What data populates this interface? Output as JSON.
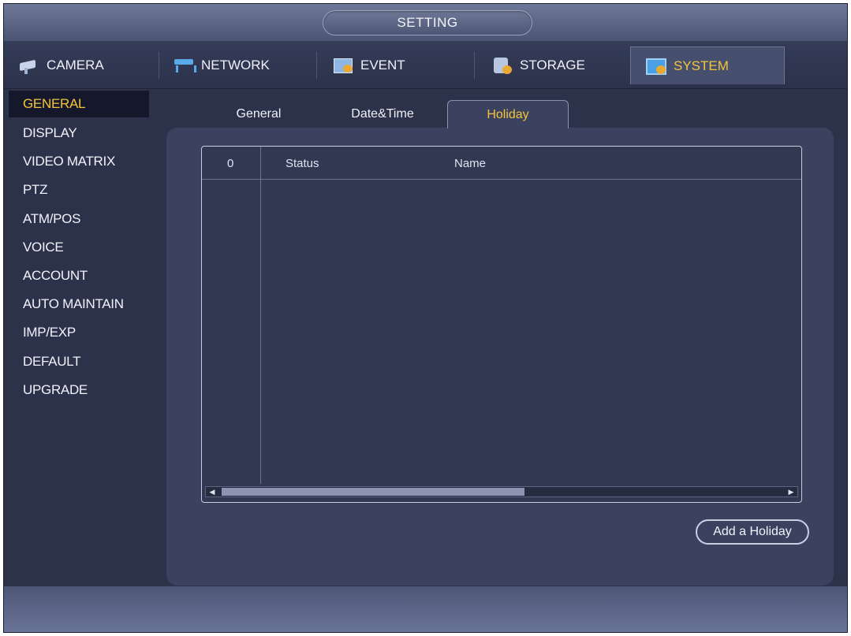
{
  "window": {
    "title": "SETTING"
  },
  "main_tabs": [
    {
      "label": "CAMERA",
      "icon": "camera-icon"
    },
    {
      "label": "NETWORK",
      "icon": "network-icon"
    },
    {
      "label": "EVENT",
      "icon": "event-icon"
    },
    {
      "label": "STORAGE",
      "icon": "storage-icon"
    },
    {
      "label": "SYSTEM",
      "icon": "system-icon",
      "active": true
    }
  ],
  "sidebar": {
    "items": [
      {
        "label": "GENERAL",
        "active": true
      },
      {
        "label": "DISPLAY"
      },
      {
        "label": "VIDEO MATRIX"
      },
      {
        "label": "PTZ"
      },
      {
        "label": "ATM/POS"
      },
      {
        "label": "VOICE"
      },
      {
        "label": "ACCOUNT"
      },
      {
        "label": "AUTO MAINTAIN"
      },
      {
        "label": "IMP/EXP"
      },
      {
        "label": "DEFAULT"
      },
      {
        "label": "UPGRADE"
      }
    ]
  },
  "sub_tabs": [
    {
      "label": "General"
    },
    {
      "label": "Date&Time"
    },
    {
      "label": "Holiday",
      "active": true
    }
  ],
  "holiday_table": {
    "columns": [
      "0",
      "Status",
      "Name"
    ],
    "rows": [],
    "scroll_position": 0
  },
  "buttons": {
    "add_holiday": "Add a Holiday"
  },
  "colors": {
    "accent_active": "#f4c43a",
    "background": "#2c3249",
    "panel": "#3b4260"
  }
}
